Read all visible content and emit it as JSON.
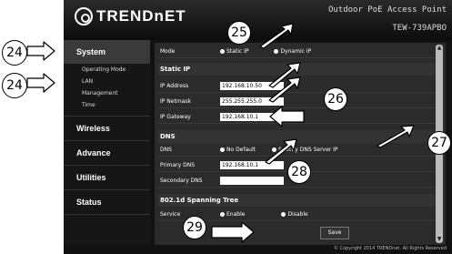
{
  "header": {
    "logo_text": "TRENDnET",
    "product_title": "Outdoor PoE Access Point",
    "model": "TEW-739APBO"
  },
  "sidebar": {
    "groups": [
      {
        "label": "System",
        "items": [
          "Operating Mode",
          "LAN",
          "Management",
          "Time"
        ]
      },
      {
        "label": "Wireless"
      },
      {
        "label": "Advance"
      },
      {
        "label": "Utilities"
      },
      {
        "label": "Status"
      }
    ]
  },
  "mode": {
    "label": "Mode",
    "option1": "Static IP",
    "option2": "Dynamic IP"
  },
  "static_ip": {
    "title": "Static IP",
    "ip_label": "IP Address",
    "ip_value": "192.168.10.50",
    "netmask_label": "IP Netmask",
    "netmask_value": "255.255.255.0",
    "gateway_label": "IP Gateway",
    "gateway_value": "192.168.10.1"
  },
  "dns": {
    "title": "DNS",
    "dns_label": "DNS",
    "option1": "No Default",
    "option2": "Specify DNS Server IP",
    "primary_label": "Primary DNS",
    "primary_value": "192.168.10.1",
    "secondary_label": "Secondary DNS",
    "secondary_value": ""
  },
  "spanning": {
    "title": "802.1d Spanning Tree",
    "service_label": "Service",
    "option1": "Enable",
    "option2": "Disable"
  },
  "save_label": "Save",
  "copyright": "© Copyright 2014 TRENDnet. All Rights Reserved",
  "callouts": {
    "c24a": "24",
    "c24b": "24",
    "c25": "25",
    "c26": "26",
    "c27": "27",
    "c28": "28",
    "c29": "29"
  }
}
